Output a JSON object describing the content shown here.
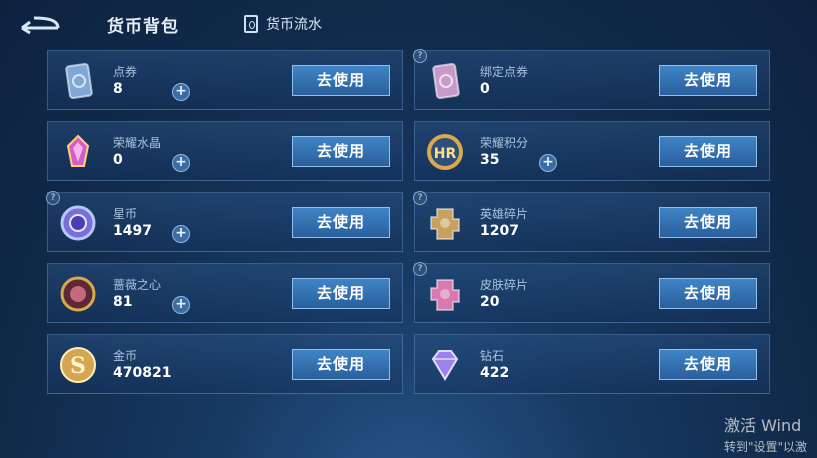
{
  "header": {
    "title": "货币背包",
    "flow_link": "货币流水"
  },
  "currencies": [
    {
      "name": "点券",
      "amount": "8",
      "has_plus": true,
      "has_help": false,
      "icon": "voucher-card-icon",
      "color": "#7fa7d8"
    },
    {
      "name": "绑定点券",
      "amount": "0",
      "has_plus": false,
      "has_help": true,
      "icon": "bound-voucher-card-icon",
      "color": "#c79ac9"
    },
    {
      "name": "荣耀水晶",
      "amount": "0",
      "has_plus": true,
      "has_help": false,
      "icon": "glory-crystal-icon",
      "color": "#d65cc8"
    },
    {
      "name": "荣耀积分",
      "amount": "35",
      "has_plus": true,
      "has_help": false,
      "icon": "glory-points-icon",
      "color": "#d9a94a"
    },
    {
      "name": "星币",
      "amount": "1497",
      "has_plus": true,
      "has_help": true,
      "icon": "star-coin-icon",
      "color": "#7a6ed8"
    },
    {
      "name": "英雄碎片",
      "amount": "1207",
      "has_plus": false,
      "has_help": true,
      "icon": "hero-fragment-icon",
      "color": "#c8a160"
    },
    {
      "name": "蔷薇之心",
      "amount": "81",
      "has_plus": true,
      "has_help": false,
      "icon": "rose-heart-icon",
      "color": "#c46a7a"
    },
    {
      "name": "皮肤碎片",
      "amount": "20",
      "has_plus": false,
      "has_help": true,
      "icon": "skin-fragment-icon",
      "color": "#d87ab0"
    },
    {
      "name": "金币",
      "amount": "470821",
      "has_plus": false,
      "has_help": false,
      "icon": "gold-coin-icon",
      "color": "#d4a552"
    },
    {
      "name": "钻石",
      "amount": "422",
      "has_plus": false,
      "has_help": false,
      "icon": "diamond-icon",
      "color": "#9a82f0"
    }
  ],
  "use_label": "去使用",
  "plus_glyph": "+",
  "help_glyph": "?",
  "watermark": {
    "title": "激活 Wind",
    "subtitle": "转到\"设置\"以激"
  }
}
